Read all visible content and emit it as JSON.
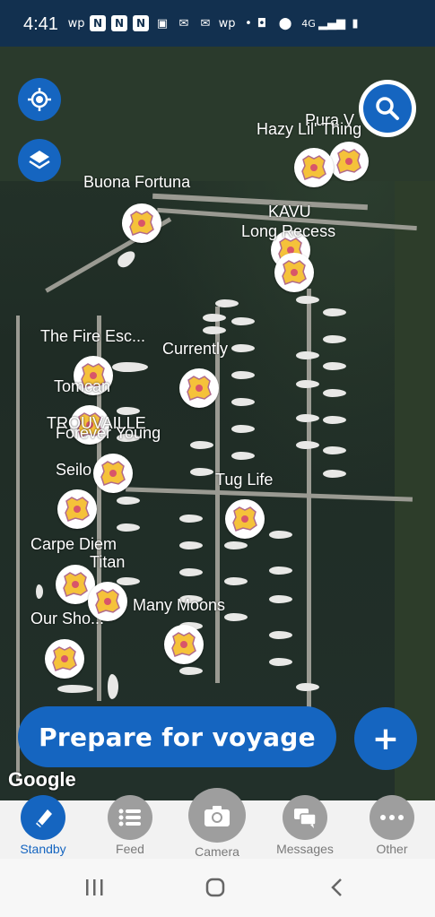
{
  "status_bar": {
    "time": "4:41",
    "left_icons": [
      "wp-icon",
      "n-icon",
      "n-icon",
      "n-icon",
      "bag-icon",
      "mail-icon",
      "mail-icon",
      "wp-icon",
      "dot-icon"
    ],
    "right_icons": [
      "nfc-icon",
      "location-icon",
      "signal-4g-icon",
      "signal-bars-icon",
      "battery-icon"
    ],
    "network": "4G"
  },
  "map": {
    "vessel_labels": [
      "Pura V",
      "Hazy Lil' Thing",
      "Buona Fortuna",
      "KAVU",
      "Long Recess",
      "The Fire Esc...",
      "Currently",
      "Tomcan",
      "TROUVAILLE",
      "Forever Young",
      "Seilo",
      "Tug Life",
      "Carpe Diem",
      "Titan",
      "Many Moons",
      "Our Sho..."
    ],
    "attribution": "Google"
  },
  "controls": {
    "locate_icon": "crosshair-icon",
    "layers_icon": "layers-icon",
    "search_icon": "search-icon"
  },
  "actions": {
    "prepare_label": "Prepare for voyage",
    "add_label": "+"
  },
  "tabs": [
    {
      "label": "Standby",
      "icon": "boat-icon",
      "active": true
    },
    {
      "label": "Feed",
      "icon": "list-icon",
      "active": false
    },
    {
      "label": "Camera",
      "icon": "camera-icon",
      "active": false
    },
    {
      "label": "Messages",
      "icon": "chat-icon",
      "active": false
    },
    {
      "label": "Other",
      "icon": "more-icon",
      "active": false
    }
  ],
  "colors": {
    "accent": "#1565c0",
    "status_bar": "#12304f",
    "tab_inactive": "#9e9e9e"
  }
}
